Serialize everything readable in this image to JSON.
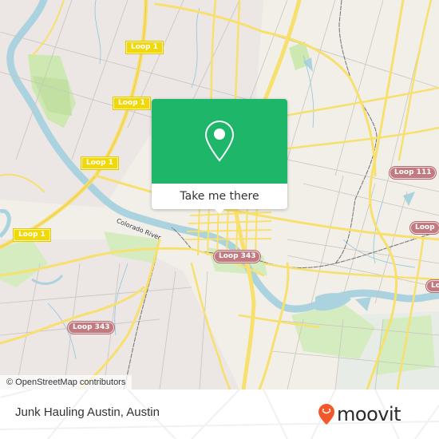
{
  "map": {
    "attribution": "© OpenStreetMap contributors",
    "river_label": "Colorado River",
    "shields": [
      {
        "label": "Loop 1",
        "style": "yellow"
      },
      {
        "label": "Loop 1",
        "style": "yellow"
      },
      {
        "label": "Loop 1",
        "style": "yellow"
      },
      {
        "label": "Loop 1",
        "style": "yellow"
      },
      {
        "label": "Loop 111",
        "style": "red"
      },
      {
        "label": "Loop",
        "style": "red"
      },
      {
        "label": "Lo",
        "style": "red"
      },
      {
        "label": "Loop 343",
        "style": "red"
      },
      {
        "label": "Loop 343",
        "style": "red"
      }
    ],
    "colors": {
      "land": "#f2efe9",
      "water": "#aad3df",
      "park": "#cde8b0",
      "road_major": "#f7e06e",
      "road_minor": "#c8c4be"
    }
  },
  "popup": {
    "icon": "location-pin-icon",
    "action_label": "Take me there",
    "accent_color": "#1eb76a"
  },
  "footer": {
    "place_name": "Junk Hauling Austin, Austin",
    "logo_text": "moovit",
    "logo_icon": "moovit-pin-smile-icon",
    "logo_color": "#f1592a"
  }
}
